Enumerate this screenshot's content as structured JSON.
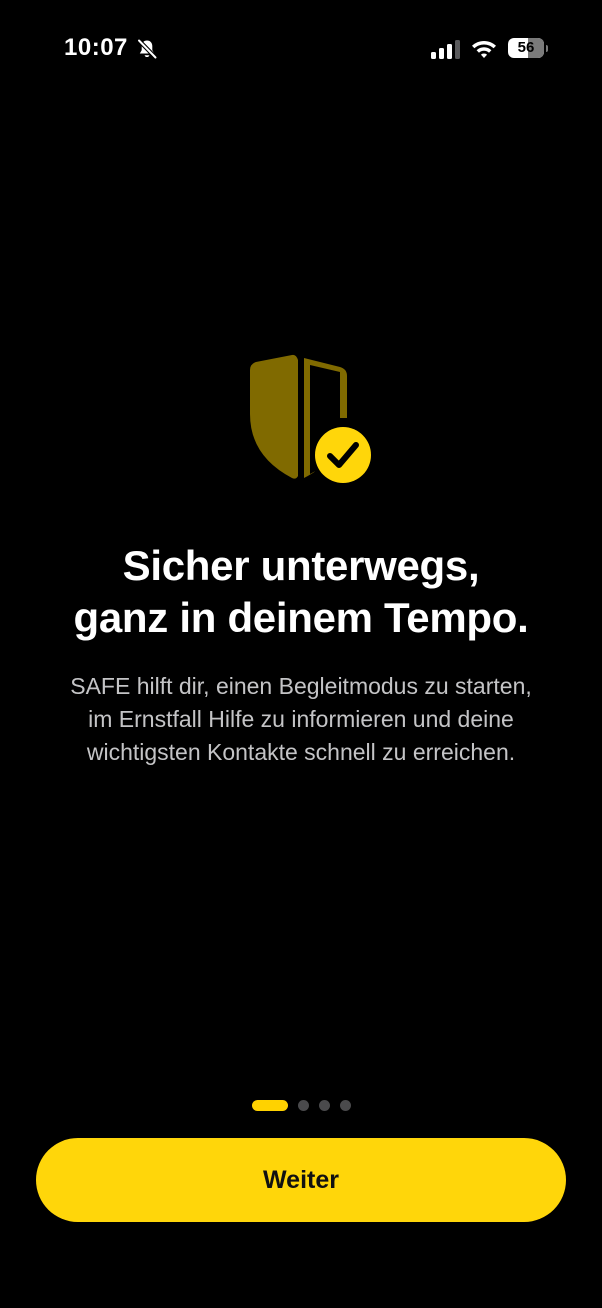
{
  "status_bar": {
    "time": "10:07",
    "battery_level": "56",
    "icons": [
      "bell-slash-icon",
      "cellular-signal-icon",
      "wifi-icon",
      "battery-icon"
    ]
  },
  "hero": {
    "icon": "shield-check-icon",
    "colors": {
      "shield": "#806a00",
      "badge": "#ffd60a",
      "check": "#000000"
    }
  },
  "headline": {
    "line1": "Sicher unterwegs,",
    "line2": "ganz in deinem Tempo."
  },
  "description": {
    "line1": "SAFE hilft dir, einen Begleitmodus zu starten,",
    "line2": "im Ernstfall Hilfe zu informieren und deine",
    "line3": "wichtigsten Kontakte schnell zu erreichen."
  },
  "pager": {
    "current_page": 1,
    "total_pages": 4
  },
  "primary_button": {
    "label": "Weiter"
  },
  "colors": {
    "background": "#000000",
    "accent": "#ffd60a",
    "text_primary": "#ffffff",
    "text_secondary": "#c4c4c6",
    "inactive_dot": "#4a4a4c"
  }
}
